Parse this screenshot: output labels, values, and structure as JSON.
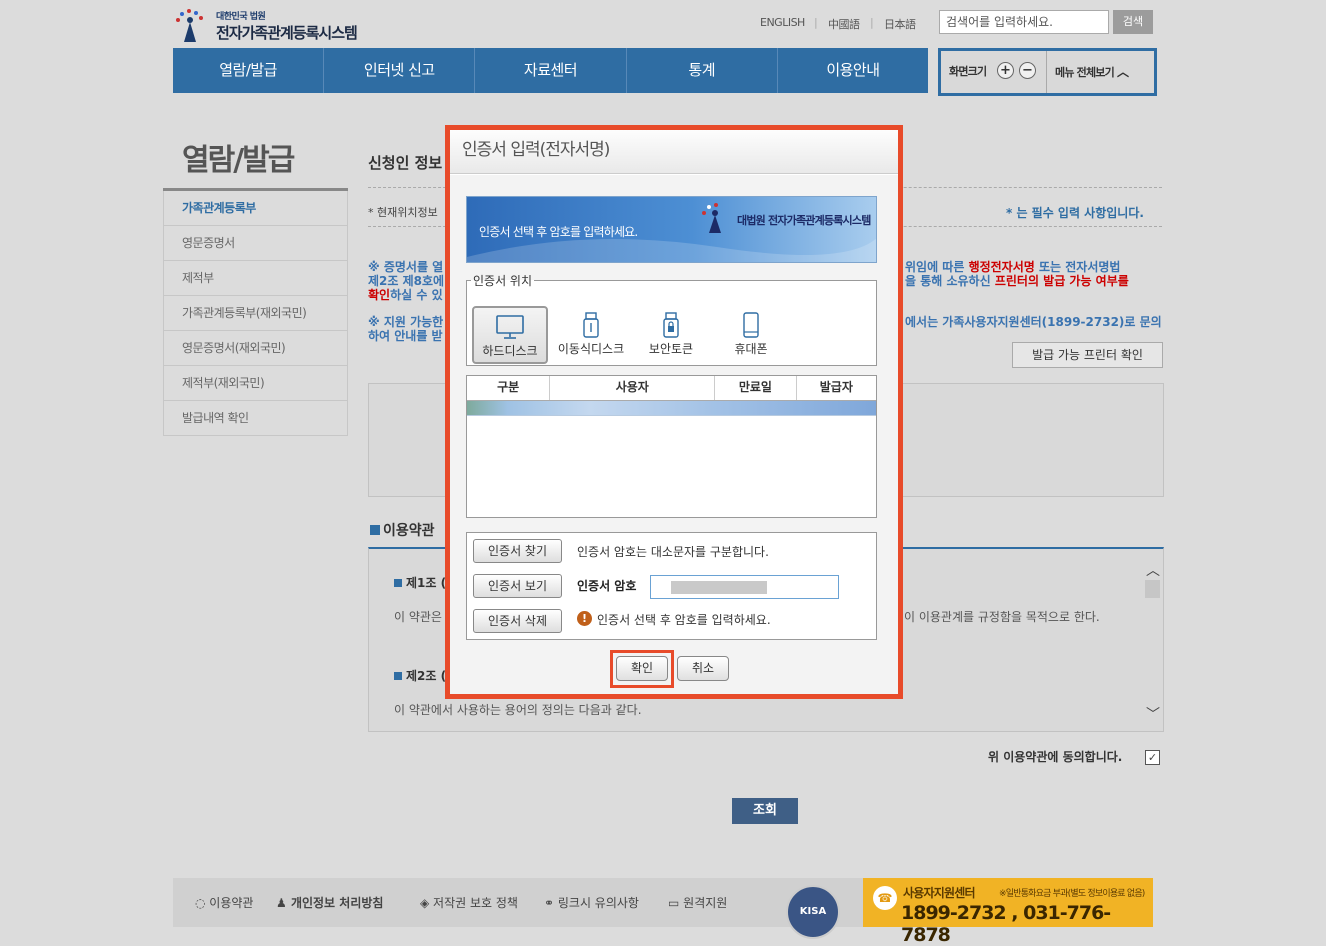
{
  "header": {
    "logo_sub": "대한민국 법원",
    "logo_title": "전자가족관계등록시스템",
    "languages": [
      "ENGLISH",
      "中國語",
      "日本語"
    ],
    "search_placeholder": "검색어를 입력하세요.",
    "search_button": "검색",
    "font_size_label": "화면크기",
    "zoom_in": "+",
    "zoom_out": "−",
    "all_menu": "메뉴 전체보기"
  },
  "nav": [
    "열람/발급",
    "인터넷 신고",
    "자료센터",
    "통계",
    "이용안내"
  ],
  "sidebar": {
    "title": "열람/발급",
    "items": [
      "가족관계등록부",
      "영문증명서",
      "제적부",
      "가족관계등록부(재외국민)",
      "영문증명서(재외국민)",
      "제적부(재외국민)",
      "발급내역 확인"
    ]
  },
  "content": {
    "section_title": "신청인 정보",
    "location_note": "* 현재위치정보",
    "required_note": "* 는 필수 입력 사항입니다.",
    "notice1_a": "※ 증명서를 열",
    "notice1_b": "제2조 제8호에",
    "notice1_c": "확인",
    "notice1_c2": "하실 수 있",
    "notice1_r1a": "위임에 따른 ",
    "notice1_r1red": "행정전자서명",
    "notice1_r1b": " 또는 전자서명법",
    "notice1_r2a": "을 통해 소유하신 ",
    "notice1_r2red": "프린터의 발급 가능 여부를",
    "notice2_a": "※ 지원 가능한",
    "notice2_b": "하여 안내를 받",
    "notice2_r": "에서는 가족사용자지원센터(1899-2732)로 문의",
    "printer_button": "발급 가능 프린터 확인",
    "terms_title": "이용약관",
    "art1": "제1조 (",
    "art1_text_l": "이 약관은",
    "art1_text_r": "이 이용관계를 규정함을 목적으로 한다.",
    "art2": "제2조 (",
    "art2_text": "이 약관에서 사용하는 용어의 정의는 다음과 같다.",
    "agree_label": "위 이용약관에 동의합니다.",
    "agree_check": "✓",
    "lookup_button": "조회"
  },
  "footer": {
    "links": [
      "이용약관",
      "개인정보 처리방침",
      "저작권 보호 정책",
      "링크시 유의사항",
      "원격지원"
    ],
    "kisa": "KISA",
    "support_title": "사용자지원센터",
    "support_note": "※일반통화요금 부과(별도 정보이용료 없음)",
    "support_phone": "1899-2732 , 031-776-7878"
  },
  "dialog": {
    "title": "인증서 입력(전자서명)",
    "banner_text": "인증서 선택 후 암호를 입력하세요.",
    "banner_brand": "대법원 전자가족관계등록시스템",
    "location_legend": "인증서 위치",
    "locations": [
      "하드디스크",
      "이동식디스크",
      "보안토큰",
      "휴대폰"
    ],
    "table_headers": [
      "구분",
      "사용자",
      "만료일",
      "발급자"
    ],
    "find_button": "인증서 찾기",
    "view_button": "인증서 보기",
    "delete_button": "인증서 삭제",
    "case_note": "인증서 암호는 대소문자를 구분합니다.",
    "password_label": "인증서 암호",
    "warning": "인증서 선택 후 암호를 입력하세요.",
    "ok_button": "확인",
    "cancel_button": "취소"
  }
}
